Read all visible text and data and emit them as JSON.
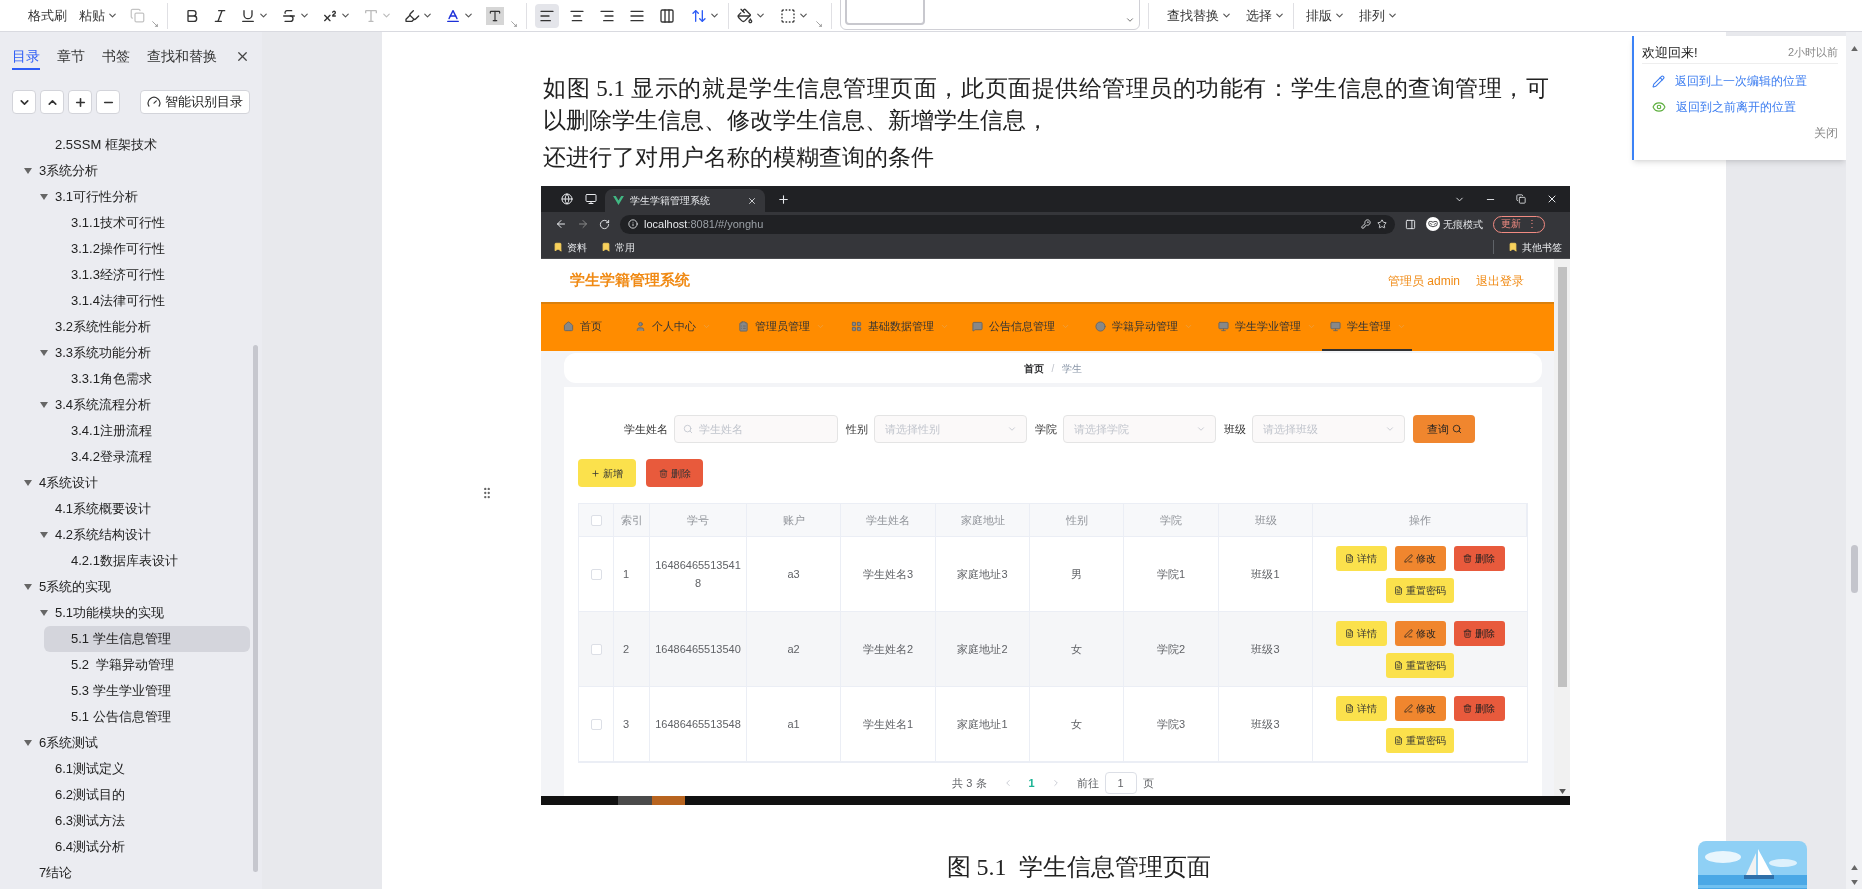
{
  "toolbar": {
    "format_painter": "格式刷",
    "paste": "粘贴",
    "copy_disabled": true,
    "align_buttons": [
      {
        "selected": true
      },
      {
        "selected": false
      },
      {
        "selected": false
      },
      {
        "selected": false
      },
      {
        "selected": false
      }
    ],
    "find_replace": "查找替换",
    "select": "选择",
    "layout": "排版",
    "arrange": "排列"
  },
  "nav_panel": {
    "tabs": [
      {
        "label": "目录",
        "selected": true
      },
      {
        "label": "章节",
        "selected": false
      },
      {
        "label": "书签",
        "selected": false
      },
      {
        "label": "查找和替换",
        "selected": false
      }
    ],
    "smart_toc_button": "智能识别目录",
    "outline": [
      {
        "children": [
          {
            "title": "2.5SSM 框架技术",
            "selected": false
          }
        ]
      },
      {
        "title": "3系统分析",
        "selected": false,
        "expanded": true,
        "children": [
          {
            "title": "3.1可行性分析",
            "selected": false,
            "expanded": true,
            "children": [
              {
                "title": "3.1.1技术可行性",
                "selected": false
              },
              {
                "title": "3.1.2操作可行性",
                "selected": false
              },
              {
                "title": "3.1.3经济可行性",
                "selected": false
              },
              {
                "title": "3.1.4法律可行性",
                "selected": false
              }
            ]
          },
          {
            "title": "3.2系统性能分析",
            "selected": false
          },
          {
            "title": "3.3系统功能分析",
            "selected": false,
            "expanded": true,
            "children": [
              {
                "title": "3.3.1角色需求",
                "selected": false
              }
            ]
          },
          {
            "title": "3.4系统流程分析",
            "selected": false,
            "expanded": true,
            "children": [
              {
                "title": "3.4.1注册流程",
                "selected": false
              },
              {
                "title": "3.4.2登录流程",
                "selected": false
              }
            ]
          }
        ]
      },
      {
        "title": "4系统设计",
        "selected": false,
        "expanded": true,
        "children": [
          {
            "title": "4.1系统概要设计",
            "selected": false
          },
          {
            "title": "4.2系统结构设计",
            "selected": false,
            "expanded": true,
            "children": [
              {
                "title": "4.2.1数据库表设计",
                "selected": false
              }
            ]
          }
        ]
      },
      {
        "title": "5系统的实现",
        "selected": false,
        "expanded": true,
        "children": [
          {
            "title": "5.1功能模块的实现",
            "selected": false,
            "expanded": true,
            "children": [
              {
                "title": "5.1 学生信息管理",
                "selected": true
              },
              {
                "title": "5.2  学籍异动管理",
                "selected": false
              },
              {
                "title": "5.3 学生学业管理",
                "selected": false
              },
              {
                "title": "5.1 公告信息管理",
                "selected": false
              }
            ]
          }
        ]
      },
      {
        "title": "6系统测试",
        "selected": false,
        "expanded": true,
        "children": [
          {
            "title": "6.1测试定义",
            "selected": false
          },
          {
            "title": "6.2测试目的",
            "selected": false
          },
          {
            "title": "6.3测试方法",
            "selected": false
          },
          {
            "title": "6.4测试分析",
            "selected": false
          }
        ]
      },
      {
        "title": "7结论",
        "selected": false
      }
    ]
  },
  "document": {
    "paragraphs": [
      "如图 5.1 显示的就是学生信息管理页面，此页面提供给管理员的功能有：学生信息的查询管理，可以删除学生信息、修改学生信息、新增学生信息，",
      "还进行了对用户名称的模糊查询的条件"
    ],
    "figure_caption": "图 5.1  学生信息管理页面"
  },
  "screenshot": {
    "browser": {
      "tab_title": "学生学籍管理系统",
      "url_host": "localhost",
      "url_path": ":8081/#/yonghu",
      "incognito_label": "无痕模式",
      "update_button": "更新",
      "update_menu": "⋮",
      "bookmarks": [
        "资料",
        "常用"
      ],
      "other_bookmarks": "其他书签"
    },
    "app": {
      "title": "学生学籍管理系统",
      "user": "管理员 admin",
      "logout": "退出登录",
      "nav": [
        {
          "label": "首页",
          "selected": false,
          "dropdown": false
        },
        {
          "label": "个人中心",
          "selected": false,
          "dropdown": true
        },
        {
          "label": "管理员管理",
          "selected": false,
          "dropdown": true
        },
        {
          "label": "基础数据管理",
          "selected": false,
          "dropdown": true
        },
        {
          "label": "公告信息管理",
          "selected": false,
          "dropdown": true
        },
        {
          "label": "学籍异动管理",
          "selected": false,
          "dropdown": true
        },
        {
          "label": "学生学业管理",
          "selected": false,
          "dropdown": true
        },
        {
          "label": "学生管理",
          "selected": true,
          "dropdown": true
        }
      ],
      "breadcrumb": {
        "items": [
          "首页",
          "学生"
        ],
        "separator": "/"
      },
      "filters": [
        {
          "kind": "text",
          "label": "学生姓名",
          "placeholder": "学生姓名"
        },
        {
          "kind": "select",
          "label": "性别",
          "placeholder": "请选择性别"
        },
        {
          "kind": "select",
          "label": "学院",
          "placeholder": "请选择学院"
        },
        {
          "kind": "select",
          "label": "班级",
          "placeholder": "请选择班级"
        }
      ],
      "search_button": "查询",
      "add_button": "新增",
      "delete_button": "删除",
      "table": {
        "select_all_checked": false,
        "columns": [
          "索引",
          "学号",
          "账户",
          "学生姓名",
          "家庭地址",
          "性别",
          "学院",
          "班级",
          "操作"
        ],
        "rows": [
          {
            "checked": false,
            "cells": [
              "1",
              "164864655135418",
              "a3",
              "学生姓名3",
              "家庭地址3",
              "男",
              "学院1",
              "班级1"
            ],
            "actions": [
              "详情",
              "修改",
              "删除",
              "重置密码"
            ]
          },
          {
            "checked": false,
            "cells": [
              "2",
              "16486465513540",
              "a2",
              "学生姓名2",
              "家庭地址2",
              "女",
              "学院2",
              "班级3"
            ],
            "actions": [
              "详情",
              "修改",
              "删除",
              "重置密码"
            ]
          },
          {
            "checked": false,
            "cells": [
              "3",
              "16486465513548",
              "a1",
              "学生姓名1",
              "家庭地址1",
              "女",
              "学院3",
              "班级3"
            ],
            "actions": [
              "详情",
              "修改",
              "删除",
              "重置密码"
            ]
          }
        ]
      },
      "pagination": {
        "total": "共 3 条",
        "pages": [
          {
            "label": "1",
            "selected": true
          }
        ],
        "goto_label": "前往",
        "goto_value": "1",
        "page_unit": "页"
      }
    }
  },
  "notification": {
    "title": "欢迎回来!",
    "time": "2小时以前",
    "links": [
      "返回到上一次编辑的位置",
      "返回到之前离开的位置"
    ],
    "close": "关闭"
  }
}
